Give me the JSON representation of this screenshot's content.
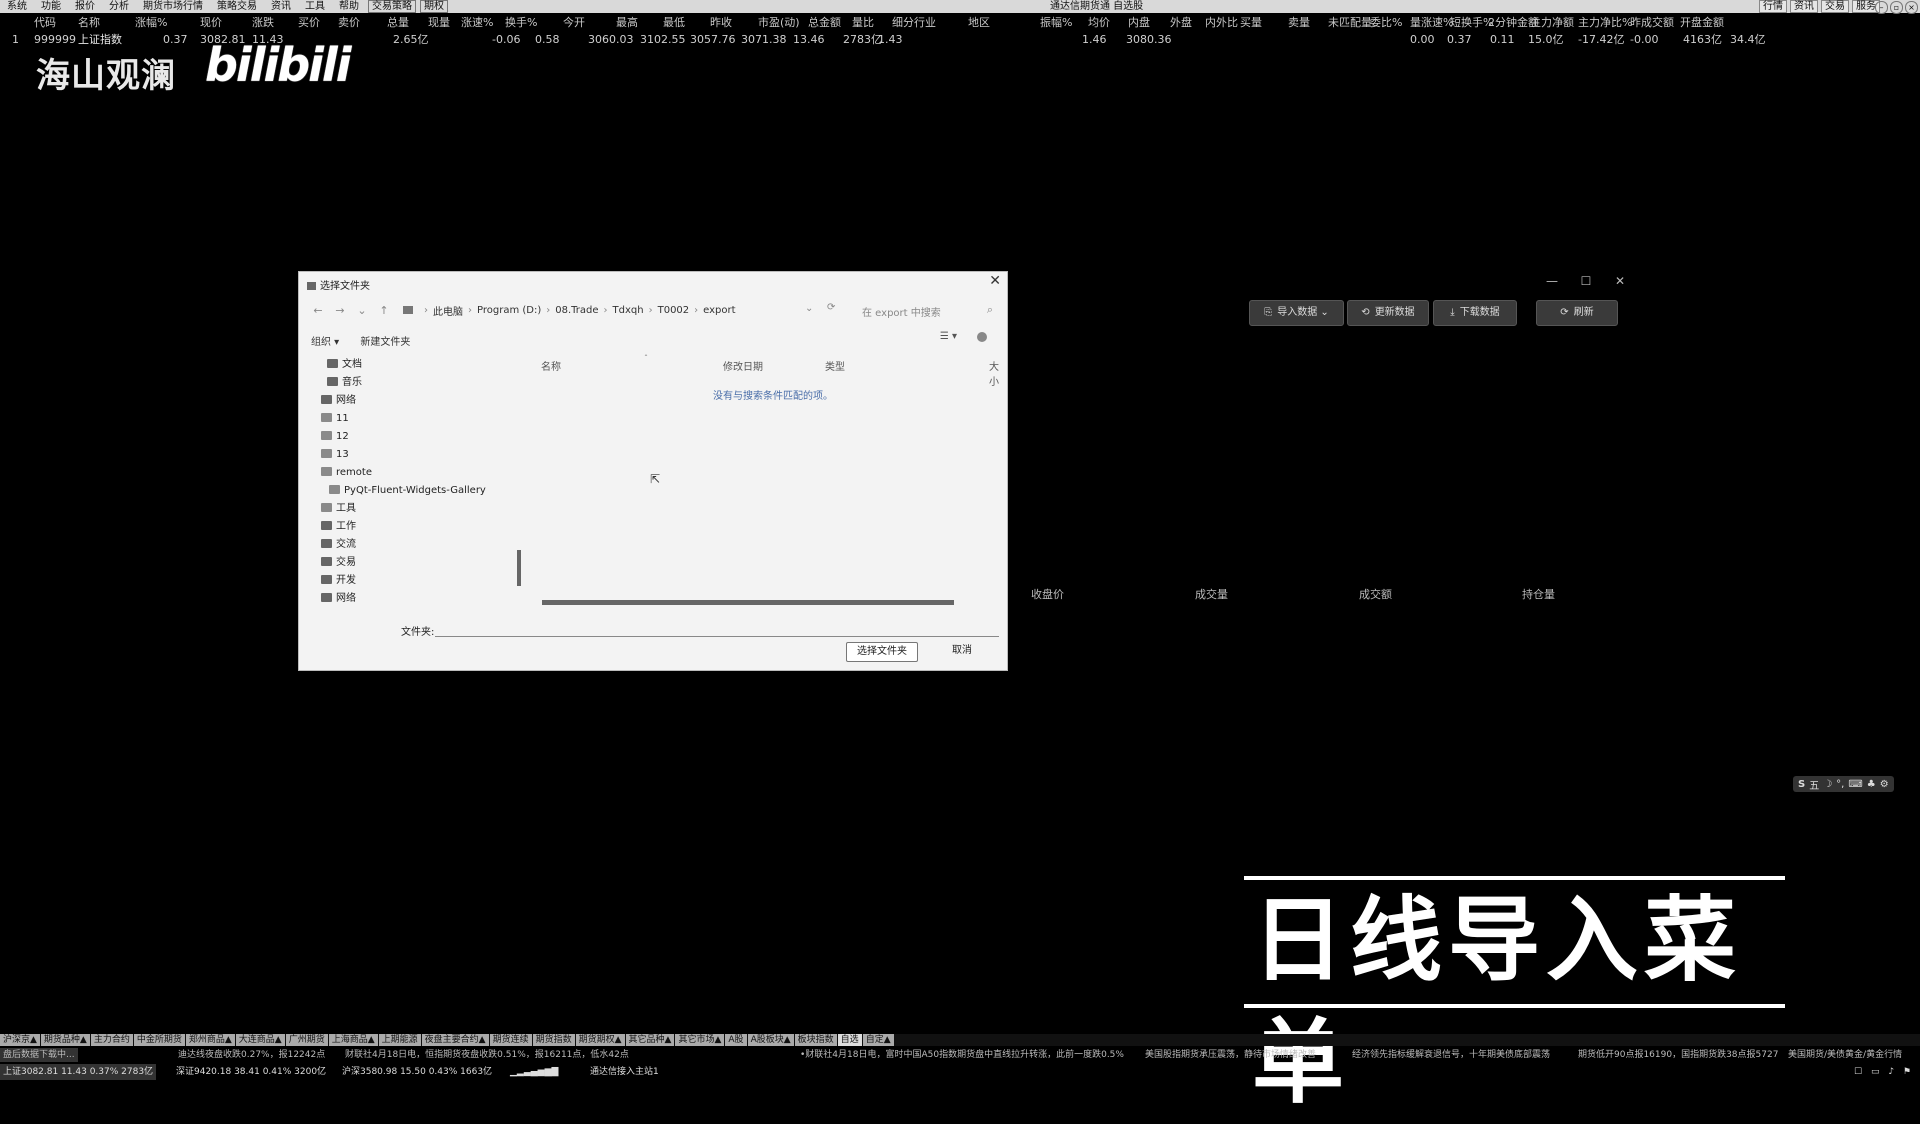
{
  "menubar": {
    "items": [
      "系统",
      "功能",
      "报价",
      "分析",
      "期货市场行情",
      "策略交易",
      "资讯",
      "工具",
      "帮助"
    ],
    "boxed": [
      "交易策略",
      "期权"
    ],
    "center": "通达信期货通 自选股",
    "right": [
      "行情",
      "资讯",
      "交易",
      "服务"
    ]
  },
  "quote_table": {
    "headers": [
      "代码",
      "名称",
      "涨幅%",
      "现价",
      "涨跌",
      "买价",
      "卖价",
      "总量",
      "现量",
      "涨速%",
      "换手%",
      "今开",
      "最高",
      "最低",
      "昨收",
      "市盈(动)",
      "总金额",
      "量比",
      "细分行业",
      "地区",
      "振幅%",
      "均价",
      "内盘",
      "外盘",
      "内外比",
      "买量",
      "卖量",
      "未匹配量",
      "委比%",
      "量涨速%",
      "短换手%",
      "2分钟金额",
      "主力净额",
      "主力净比%",
      "昨成交额",
      "开盘金额"
    ],
    "row": [
      "1",
      "999999",
      "上证指数",
      "0.37",
      "3082.81",
      "11.43",
      "",
      "",
      "2.65亿",
      "",
      "-0.06",
      "0.58",
      "3060.03",
      "3102.55",
      "3057.76",
      "3071.38",
      "13.46",
      "2783亿",
      "1.43",
      "",
      "",
      "1.46",
      "3080.36",
      "",
      "",
      "",
      "",
      "",
      "",
      "0.00",
      "0.37",
      "0.11",
      "15.0亿",
      "-17.42亿",
      "-0.00",
      "4163亿",
      "34.4亿"
    ]
  },
  "watermark": {
    "text": "海山观澜",
    "logo": "bilibili"
  },
  "panel": {
    "window_controls": [
      "—",
      "☐",
      "✕"
    ],
    "buttons": [
      {
        "icon": "⎘",
        "label": "导入数据 ⌄"
      },
      {
        "icon": "⟲",
        "label": "更新数据"
      },
      {
        "icon": "⤓",
        "label": "下载数据"
      },
      {
        "icon": "⟳",
        "label": "刷新"
      }
    ],
    "columns": [
      "收盘价",
      "成交量",
      "成交额",
      "持仓量"
    ]
  },
  "dialog": {
    "title": "选择文件夹",
    "close": "✕",
    "nav": [
      "←",
      "→",
      "⌄",
      "↑"
    ],
    "breadcrumbs": [
      "此电脑",
      "Program (D:)",
      "08.Trade",
      "Tdxqh",
      "T0002",
      "export"
    ],
    "search_placeholder": "在 export 中搜索",
    "organize": "组织 ▾",
    "new_folder": "新建文件夹",
    "columns": [
      "名称",
      "修改日期",
      "类型",
      "大小"
    ],
    "empty_message": "没有与搜索条件匹配的项。",
    "tree": [
      "文档",
      "音乐",
      "网络",
      "11",
      "12",
      "13",
      "remote",
      "PyQt-Fluent-Widgets-Gallery",
      "工具",
      "工作",
      "交流",
      "交易",
      "开发",
      "网络"
    ],
    "folder_label": "文件夹:",
    "folder_value": "",
    "select_button": "选择文件夹",
    "cancel_button": "取消"
  },
  "caption": "日线导入菜单",
  "ime": [
    "S",
    "五",
    "☽",
    "°,",
    "⌨",
    "♣",
    "⚙"
  ],
  "bottom_tabs": [
    "沪深京▲",
    "期货品种▲",
    "主力合约",
    "中金所期货",
    "郑州商品▲",
    "大连商品▲",
    "广州期货",
    "上海商品▲",
    "上期能源",
    "夜盘主要合约▲",
    "期货连续",
    "期货指数",
    "期货期权▲",
    "其它品种▲",
    "其它市场▲",
    "A股",
    "A股板块▲",
    "板块指数",
    "自选",
    "自定▲"
  ],
  "news": [
    "盘后数据下载中...",
    "迪达线夜盘收跌0.27%，报12242点",
    "财联社4月18日电，恒指期货夜盘收跌0.51%，报16211点，低水42点",
    "•财联社4月18日电，富时中国A50指数期货盘中直线拉升转涨，此前一度跌0.5%",
    "美国股指期货承压震荡，静待市场情绪改善",
    "经济领先指标缓解衰退信号，十年期美债底部震荡",
    "期货低开90点报16190，国指期货跌38点报5727",
    "美国期货/美债黄金/黄金行情"
  ],
  "status": {
    "index1": "上证3082.81  11.43  0.37%  2783亿",
    "index2": "深证9420.18  38.41  0.41%  3200亿",
    "index3": "沪深3580.98  15.50  0.43%  1663亿",
    "conn": "通达信接入主站1"
  },
  "colors": {
    "background": "#000000",
    "dialog": "#f3f3f3",
    "caption": "#ffffff"
  }
}
